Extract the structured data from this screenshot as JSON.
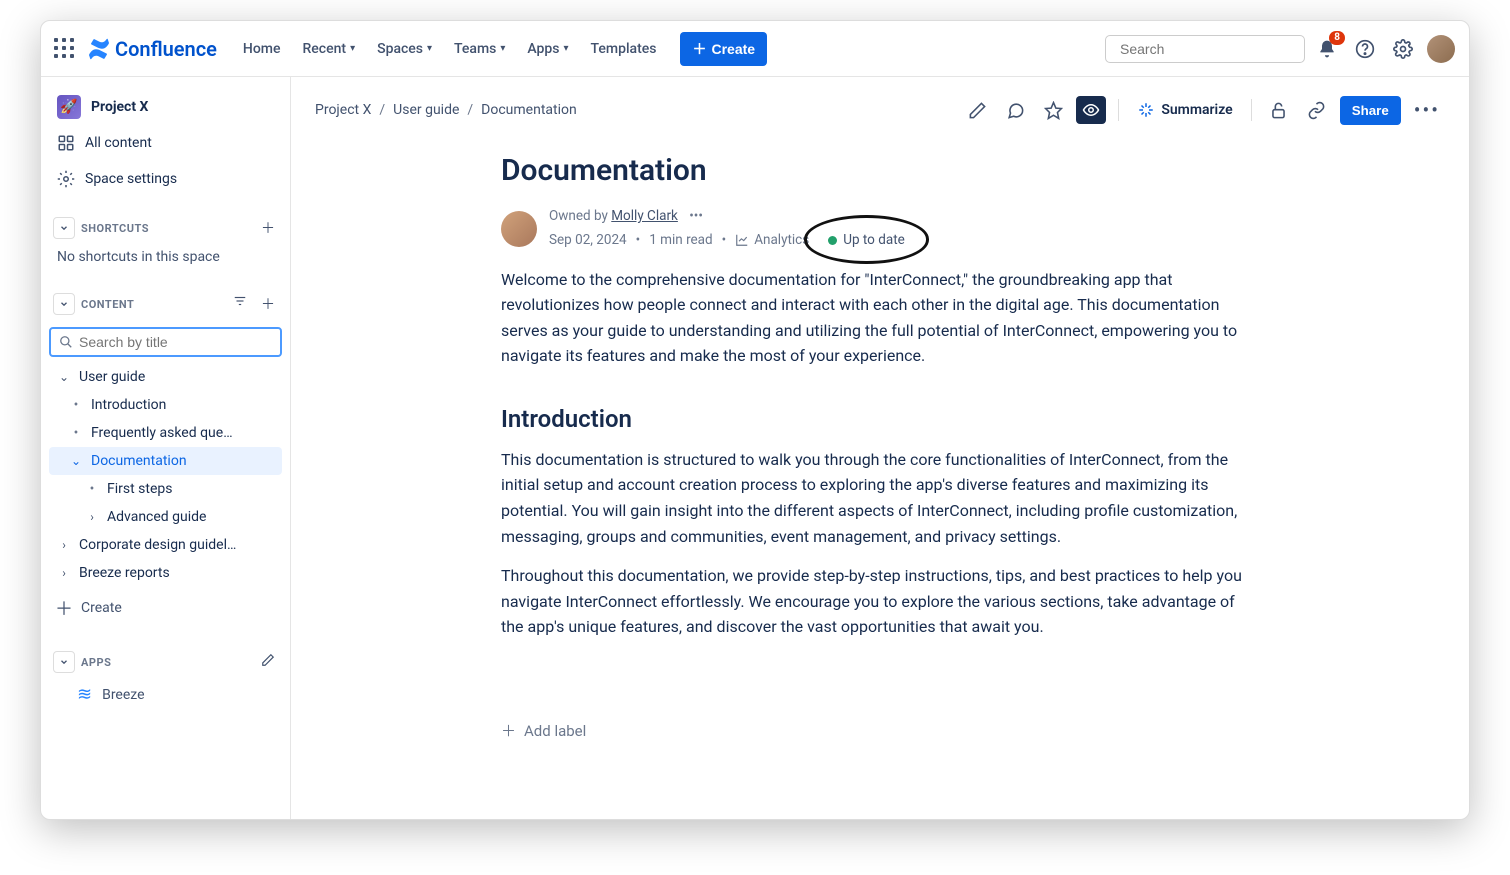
{
  "topnav": {
    "product_name": "Confluence",
    "items": {
      "home": "Home",
      "recent": "Recent",
      "spaces": "Spaces",
      "teams": "Teams",
      "apps": "Apps",
      "templates": "Templates"
    },
    "create": "Create",
    "search_placeholder": "Search",
    "notification_count": "8"
  },
  "sidebar": {
    "space_name": "Project X",
    "all_content": "All content",
    "space_settings": "Space settings",
    "shortcuts_label": "SHORTCUTS",
    "shortcuts_empty": "No shortcuts in this space",
    "content_label": "CONTENT",
    "search_placeholder": "Search by title",
    "tree": {
      "user_guide": "User guide",
      "introduction": "Introduction",
      "faq": "Frequently asked que…",
      "documentation": "Documentation",
      "first_steps": "First steps",
      "advanced_guide": "Advanced guide",
      "corporate": "Corporate design guidel…",
      "breeze_reports": "Breeze reports"
    },
    "create": "Create",
    "apps_label": "APPS",
    "breeze": "Breeze"
  },
  "breadcrumbs": {
    "a": "Project X",
    "b": "User guide",
    "c": "Documentation"
  },
  "actions": {
    "summarize": "Summarize",
    "share": "Share"
  },
  "page": {
    "title": "Documentation",
    "owned_by_prefix": "Owned by ",
    "owner": "Molly Clark",
    "date": "Sep 02, 2024",
    "read_time": "1 min read",
    "analytics": "Analytics",
    "status": "Up to date",
    "p1": "Welcome to the comprehensive documentation for \"InterConnect,\" the groundbreaking app that revolutionizes how people connect and interact with each other in the digital age. This documentation serves as your guide to understanding and utilizing the full potential of InterConnect, empowering you to navigate its features and make the most of your experience.",
    "h2": "Introduction",
    "p2": "This documentation is structured to walk you through the core functionalities of InterConnect, from the initial setup and account creation process to exploring the app's diverse features and maximizing its potential. You will gain insight into the different aspects of InterConnect, including profile customization, messaging, groups and communities, event management, and privacy settings.",
    "p3": "Throughout this documentation, we provide step-by-step instructions, tips, and best practices to help you navigate InterConnect effortlessly. We encourage you to explore the various sections, take advantage of the app's unique features, and discover the vast opportunities that await you.",
    "add_label": "Add label"
  }
}
